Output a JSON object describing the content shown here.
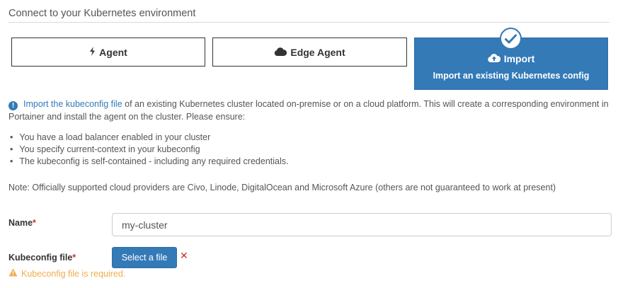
{
  "section": {
    "title": "Connect to your Kubernetes environment"
  },
  "options": {
    "agent": {
      "label": "Agent",
      "icon": "bolt-icon"
    },
    "edge_agent": {
      "label": "Edge Agent",
      "icon": "cloud-icon"
    },
    "import": {
      "label": "Import",
      "subtitle": "Import an existing Kubernetes config",
      "icon": "cloud-upload-icon",
      "selected": true
    }
  },
  "info": {
    "link_text": "Import the kubeconfig file",
    "text": " of an existing Kubernetes cluster located on-premise or on a cloud platform. This will create a corresponding environment in Portainer and install the agent on the cluster. Please ensure:"
  },
  "requirements": [
    "You have a load balancer enabled in your cluster",
    "You specify current-context in your kubeconfig",
    "The kubeconfig is self-contained - including any required credentials."
  ],
  "note": "Note: Officially supported cloud providers are Civo, Linode, DigitalOcean and Microsoft Azure (others are not guaranteed to work at present)",
  "form": {
    "name_label": "Name",
    "name_value": "my-cluster",
    "kubeconfig_label": "Kubeconfig file",
    "required_marker": "*",
    "select_file_label": "Select a file",
    "remove_symbol": "✕",
    "warning_text": "Kubeconfig file is required."
  },
  "colors": {
    "primary": "#337ab7",
    "danger": "#c9302c",
    "warning": "#f0ad4e"
  }
}
